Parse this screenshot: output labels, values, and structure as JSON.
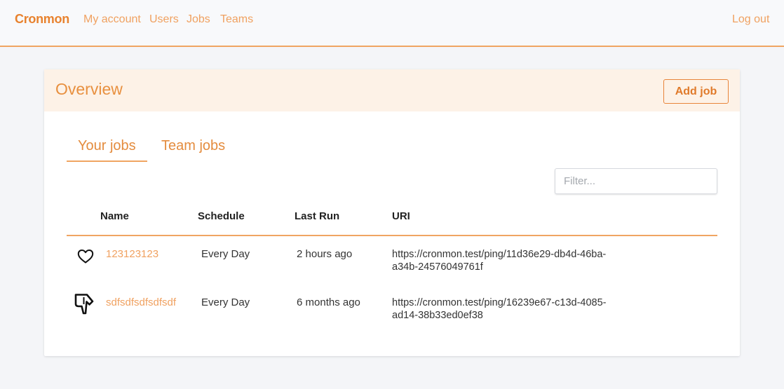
{
  "nav": {
    "brand": "Cronmon",
    "links": [
      "My account",
      "Users",
      "Jobs",
      "Teams"
    ],
    "logout": "Log out"
  },
  "card": {
    "title": "Overview",
    "add_job_label": "Add job"
  },
  "tabs": [
    "Your jobs",
    "Team jobs"
  ],
  "active_tab": "Your jobs",
  "filter": {
    "placeholder": "Filter...",
    "value": ""
  },
  "table": {
    "headers": [
      "Name",
      "Schedule",
      "Last Run",
      "URI"
    ],
    "rows": [
      {
        "status_icon": "heart-icon",
        "name": "123123123",
        "schedule": "Every Day",
        "last_run": "2 hours ago",
        "uri_line1": "https://cronmon.test/ping/11d36e29-db4d-46ba-",
        "uri_line2": "a34b-24576049761f"
      },
      {
        "status_icon": "thumbs-down-icon",
        "name": "sdfsdfsdfsdfsdf",
        "schedule": "Every Day",
        "last_run": "6 months ago",
        "uri_line1": "https://cronmon.test/ping/16239e67-c13d-4085-",
        "uri_line2": "ad14-38b33ed0ef38"
      }
    ]
  },
  "colors": {
    "accent": "#e8822e",
    "accent_light": "#f0a160",
    "header_bg": "#fdf2e7",
    "page_bg": "#f4f5f8"
  }
}
